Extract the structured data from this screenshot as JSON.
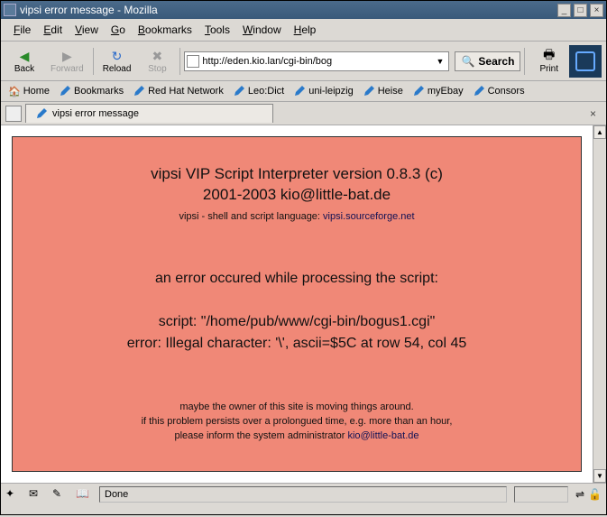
{
  "window": {
    "title": "vipsi error message - Mozilla"
  },
  "menu": {
    "file": "File",
    "edit": "Edit",
    "view": "View",
    "go": "Go",
    "bookmarks": "Bookmarks",
    "tools": "Tools",
    "window": "Window",
    "help": "Help"
  },
  "toolbar": {
    "back": "Back",
    "forward": "Forward",
    "reload": "Reload",
    "stop": "Stop",
    "search": "Search",
    "print": "Print"
  },
  "url": {
    "value": "http://eden.kio.lan/cgi-bin/bog"
  },
  "bookmarks_bar": [
    {
      "label": "Home",
      "icon": "home"
    },
    {
      "label": "Bookmarks",
      "icon": "pen"
    },
    {
      "label": "Red Hat Network",
      "icon": "pen"
    },
    {
      "label": "Leo:Dict",
      "icon": "pen"
    },
    {
      "label": "uni-leipzig",
      "icon": "pen"
    },
    {
      "label": "Heise",
      "icon": "pen"
    },
    {
      "label": "myEbay",
      "icon": "pen"
    },
    {
      "label": "Consors",
      "icon": "pen"
    }
  ],
  "tab": {
    "title": "vipsi error message"
  },
  "error_page": {
    "heading_l1": "vipsi VIP Script Interpreter version 0.8.3 (c)",
    "heading_l2": "2001-2003 kio@little-bat.de",
    "subtitle_pre": "vipsi - shell and script language: ",
    "subtitle_link": "vipsi.sourceforge.net",
    "intro": "an error occured while processing the script:",
    "script_line": "script: \"/home/pub/www/cgi-bin/bogus1.cgi\"",
    "error_line": "error: Illegal character: '\\', ascii=$5C at row 54, col 45",
    "footer_l1": "maybe the owner of this site is moving things around.",
    "footer_l2": "if this problem persists over a prolongued time, e.g. more than an hour,",
    "footer_l3_pre": "please inform the system administrator ",
    "footer_link": "kio@little-bat.de"
  },
  "status": {
    "text": "Done"
  }
}
